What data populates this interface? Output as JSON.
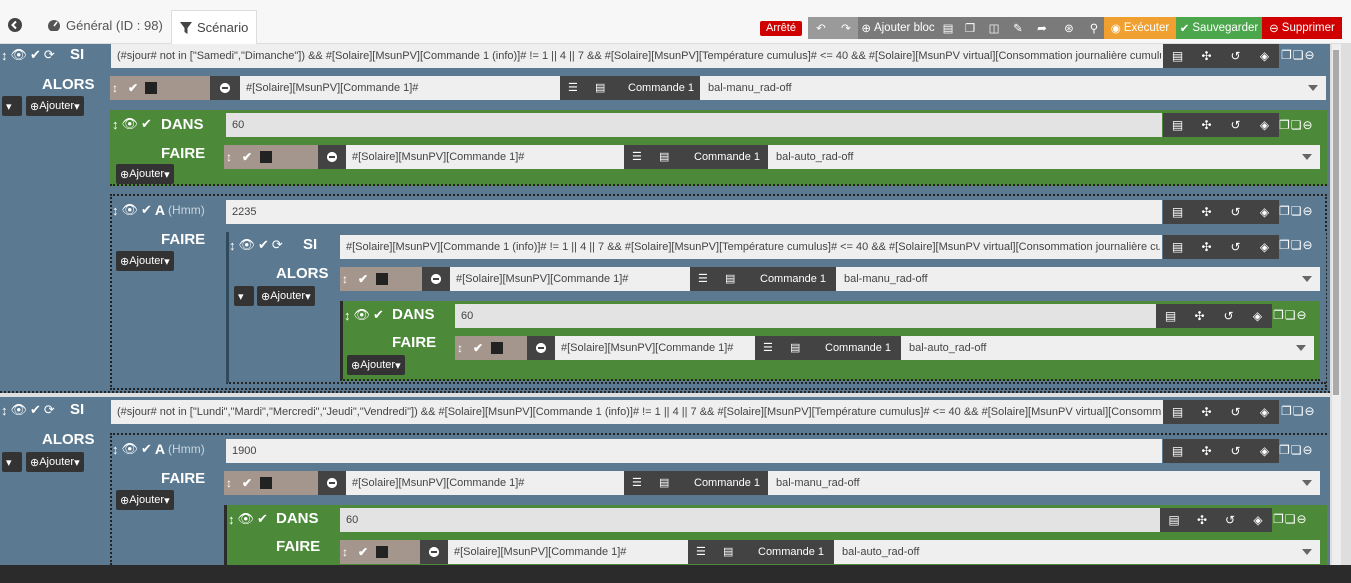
{
  "header": {
    "back_icon": "arrow-left-circle-icon",
    "tab_general": "Général (ID : 98)",
    "tab_scenario": "Scénario",
    "status": "Arrêté",
    "btn_add_block": "Ajouter bloc",
    "btn_execute": "Exécuter",
    "btn_save": "Sauvegarder",
    "btn_delete": "Supprimer",
    "colors": {
      "execute": "#f0a030",
      "save": "#4ca64c",
      "delete": "#d10000",
      "status": "#d10000"
    }
  },
  "keywords": {
    "si": "SI",
    "alors": "ALORS",
    "dans": "DANS",
    "faire": "FAIRE",
    "a": "A",
    "hmm": "(Hmm)",
    "add": "Ajouter"
  },
  "block1": {
    "condition": "(#sjour# not in [\"Samedi\",\"Dimanche\"]) && #[Solaire][MsunPV][Commande 1 (info)]# != 1 || 4 || 7 && #[Solaire][MsunPV][Température cumulus]# <= 40 && #[Solaire][MsunPV virtual][Consommation journalière cumulus",
    "cmd1": {
      "field": "#[Solaire][MsunPV][Commande 1]#",
      "name": "Commande 1",
      "value": "bal-manu_rad-off"
    },
    "dans": {
      "value": "60",
      "cmd": {
        "field": "#[Solaire][MsunPV][Commande 1]#",
        "name": "Commande 1",
        "value": "bal-auto_rad-off"
      }
    },
    "a": {
      "value": "2235",
      "condition": "#[Solaire][MsunPV][Commande 1 (info)]# != 1 || 4 || 7 && #[Solaire][MsunPV][Température cumulus]# <= 40 && #[Solaire][MsunPV virtual][Consommation journalière cu",
      "cmd1": {
        "field": "#[Solaire][MsunPV][Commande 1]#",
        "name": "Commande 1",
        "value": "bal-manu_rad-off"
      },
      "dans": {
        "value": "60",
        "cmd": {
          "field": "#[Solaire][MsunPV][Commande 1]#",
          "name": "Commande 1",
          "value": "bal-auto_rad-off"
        }
      }
    }
  },
  "block2": {
    "condition": "(#sjour# not in [\"Lundi\",\"Mardi\",\"Mercredi\",\"Jeudi\",\"Vendredi\"]) && #[Solaire][MsunPV][Commande 1 (info)]# != 1 || 4 || 7 && #[Solaire][MsunPV][Température cumulus]# <= 40 && #[Solaire][MsunPV virtual][Consommatic",
    "a": {
      "value": "1900",
      "cmd1": {
        "field": "#[Solaire][MsunPV][Commande 1]#",
        "name": "Commande 1",
        "value": "bal-manu_rad-off"
      },
      "dans": {
        "value": "60",
        "cmd": {
          "field": "#[Solaire][MsunPV][Commande 1]#",
          "name": "Commande 1",
          "value": "bal-auto_rad-off"
        }
      }
    }
  }
}
